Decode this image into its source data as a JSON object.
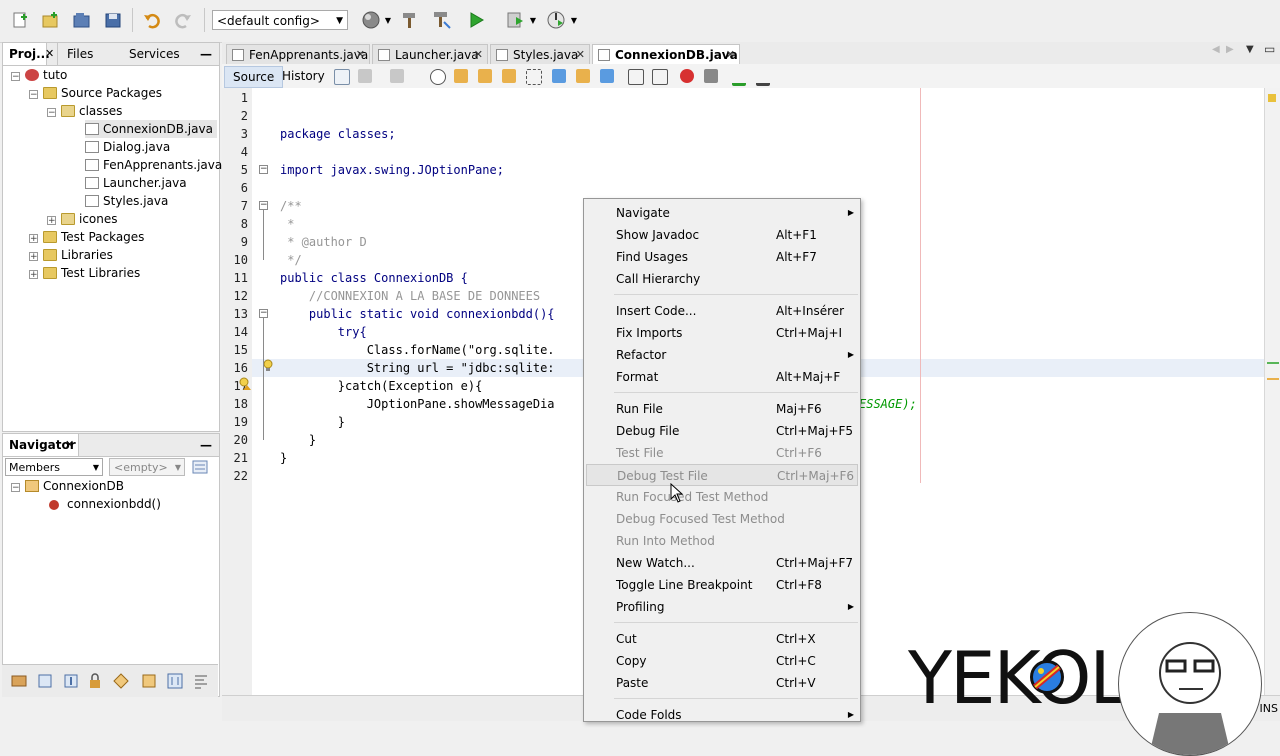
{
  "toolbar": {
    "config_select": "<default config>"
  },
  "projects_panel": {
    "tabs": [
      "Proj...",
      "Files",
      "Services"
    ],
    "tree": {
      "root": "tuto",
      "source_packages": "Source Packages",
      "package": "classes",
      "files": [
        "ConnexionDB.java",
        "Dialog.java",
        "FenApprenants.java",
        "Launcher.java",
        "Styles.java"
      ],
      "icones": "icones",
      "test_packages": "Test Packages",
      "libraries": "Libraries",
      "test_libraries": "Test Libraries"
    }
  },
  "navigator": {
    "title": "Navigator",
    "members_select": "Members",
    "filter_select": "<empty>",
    "class_name": "ConnexionDB",
    "method": "connexionbdd()"
  },
  "editor": {
    "tabs": [
      "FenApprenants.java",
      "Launcher.java",
      "Styles.java",
      "ConnexionDB.java"
    ],
    "subtabs": {
      "source": "Source",
      "history": "History"
    },
    "line_numbers": [
      "1",
      "2",
      "3",
      "4",
      "5",
      "6",
      "7",
      "8",
      "9",
      "10",
      "11",
      "12",
      "13",
      "14",
      "15",
      "16",
      "17",
      "18",
      "19",
      "20",
      "21",
      "22"
    ],
    "lines": {
      "l3": "package classes;",
      "l5": "import javax.swing.JOptionPane;",
      "l7": "/**",
      "l8": " *",
      "l9": " * @author D",
      "l10": " */",
      "l11": "public class ConnexionDB {",
      "l12": "    //CONNEXION A LA BASE DE DONNEES",
      "l13": "    public static void connexionbdd(){",
      "l14": "        try{",
      "l15": "            Class.forName(\"org.sqlite.",
      "l16": "            String url = \"jdbc:sqlite:",
      "l17": "        }catch(Exception e){",
      "l18": "            JOptionPane.showMessageDia",
      "l18_tail": "ESSAGE);",
      "l19": "        }",
      "l20": "    }",
      "l21": "}"
    },
    "status_insert": "INS"
  },
  "context_menu": {
    "items": [
      {
        "label": "Navigate",
        "shortcut": "",
        "submenu": true
      },
      {
        "label": "Show Javadoc",
        "shortcut": "Alt+F1"
      },
      {
        "label": "Find Usages",
        "shortcut": "Alt+F7"
      },
      {
        "label": "Call Hierarchy",
        "shortcut": ""
      },
      {
        "label": "Insert Code...",
        "shortcut": "Alt+Insérer"
      },
      {
        "label": "Fix Imports",
        "shortcut": "Ctrl+Maj+I"
      },
      {
        "label": "Refactor",
        "shortcut": "",
        "submenu": true
      },
      {
        "label": "Format",
        "shortcut": "Alt+Maj+F"
      },
      {
        "label": "Run File",
        "shortcut": "Maj+F6"
      },
      {
        "label": "Debug File",
        "shortcut": "Ctrl+Maj+F5"
      },
      {
        "label": "Test File",
        "shortcut": "Ctrl+F6"
      },
      {
        "label": "Debug Test File",
        "shortcut": "Ctrl+Maj+F6"
      },
      {
        "label": "Run Focused Test Method",
        "shortcut": ""
      },
      {
        "label": "Debug Focused Test Method",
        "shortcut": ""
      },
      {
        "label": "Run Into Method",
        "shortcut": ""
      },
      {
        "label": "New Watch...",
        "shortcut": "Ctrl+Maj+F7"
      },
      {
        "label": "Toggle Line Breakpoint",
        "shortcut": "Ctrl+F8"
      },
      {
        "label": "Profiling",
        "shortcut": "",
        "submenu": true
      },
      {
        "label": "Cut",
        "shortcut": "Ctrl+X"
      },
      {
        "label": "Copy",
        "shortcut": "Ctrl+C"
      },
      {
        "label": "Paste",
        "shortcut": "Ctrl+V"
      },
      {
        "label": "Code Folds",
        "shortcut": "",
        "submenu": true
      }
    ]
  },
  "watermark": {
    "text": "YEKOLA"
  },
  "colors": {
    "accent": "#dbe6f4",
    "keyword": "#000080",
    "string": "#ce7b00",
    "comment": "#969696",
    "folder": "#e7c860",
    "breakpoint": "#d73030"
  }
}
